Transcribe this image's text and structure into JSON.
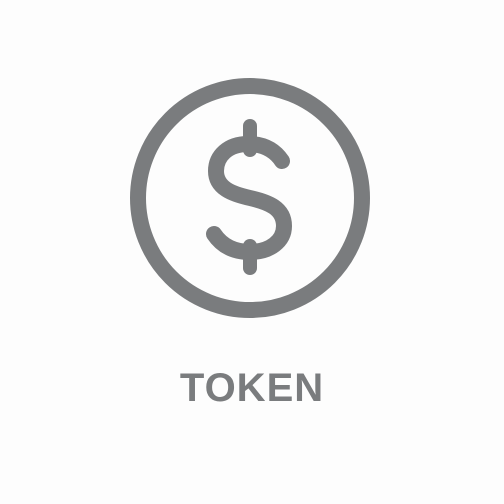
{
  "token": {
    "label": "TOKEN",
    "icon": "dollar-coin-icon",
    "color": "#7a7c7e"
  }
}
